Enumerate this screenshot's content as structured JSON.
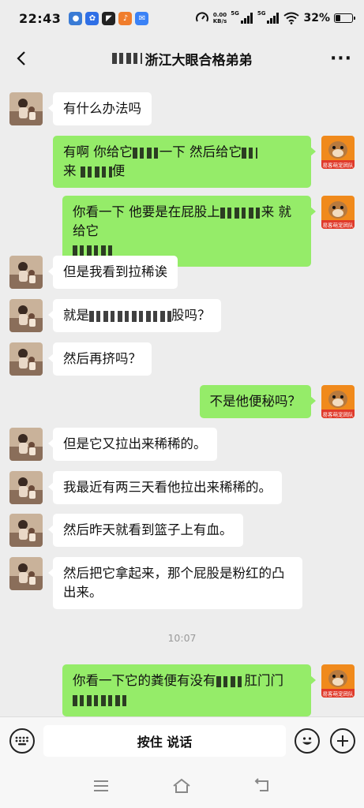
{
  "status_bar": {
    "time": "22:43",
    "net_speed_value": "0.00",
    "net_speed_unit": "KB/s",
    "signal1": "5G",
    "signal2": "5G",
    "battery": "32%",
    "battery_level": 0.32
  },
  "header": {
    "title_visible": "浙江大眼合格弟弟",
    "more": "···"
  },
  "messages": [
    {
      "side": "left",
      "text": "有什么办法吗"
    },
    {
      "side": "right",
      "parts": [
        "有啊 你给它",
        "一下 然后给它",
        "来 ",
        "便"
      ]
    },
    {
      "side": "right",
      "parts": [
        "你看一下 他要是在屁股上",
        "来 就给它",
        ""
      ]
    },
    {
      "side": "left",
      "text": "但是我看到拉稀诶"
    },
    {
      "side": "left",
      "parts": [
        "就是",
        "股吗？"
      ]
    },
    {
      "side": "left",
      "text": "然后再挤吗？"
    },
    {
      "side": "right",
      "text": "不是他便秘吗？"
    },
    {
      "side": "left",
      "text": "但是它又拉出来稀稀的。"
    },
    {
      "side": "left",
      "text": "我最近有两三天看他拉出来稀稀的。"
    },
    {
      "side": "left",
      "text": "然后昨天就看到篮子上有血。"
    },
    {
      "side": "left",
      "text": "然后把它拿起来，那个屁股是粉红的凸出来。"
    },
    {
      "side": "right",
      "parts": [
        "你看一下它的粪便有没有",
        "肛门门",
        ""
      ]
    }
  ],
  "timestamp": "10:07",
  "avatar_badge": "易客萌宠团队",
  "input_bar": {
    "hold_to_talk": "按住 说话"
  },
  "colors": {
    "bubble_right": "#95ec69",
    "bubble_left": "#ffffff",
    "background": "#ededed"
  }
}
